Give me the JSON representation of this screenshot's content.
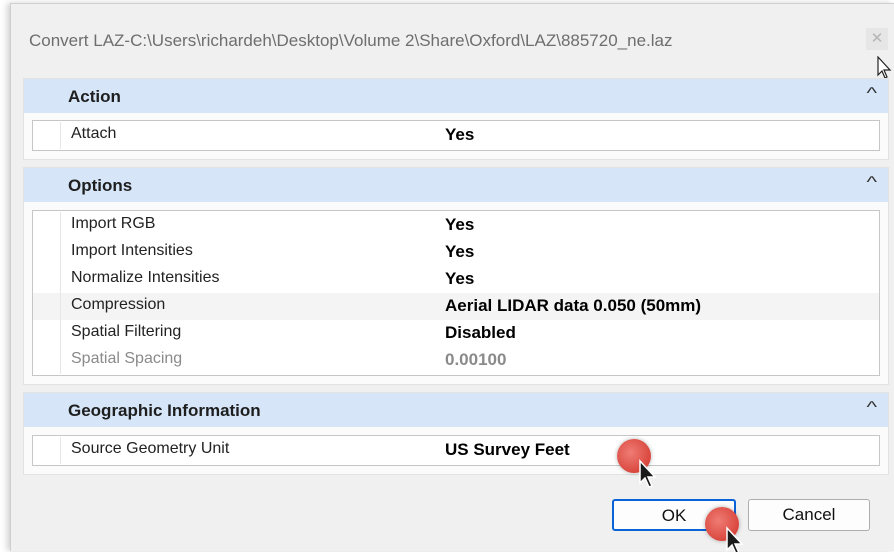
{
  "window": {
    "title": "Convert LAZ-C:\\Users\\richardeh\\Desktop\\Volume 2\\Share\\Oxford\\LAZ\\885720_ne.laz",
    "close_glyph": "✕"
  },
  "sections": {
    "action": {
      "title": "Action",
      "rows": [
        {
          "name": "Attach",
          "value": "Yes"
        }
      ]
    },
    "options": {
      "title": "Options",
      "rows": [
        {
          "name": "Import RGB",
          "value": "Yes"
        },
        {
          "name": "Import Intensities",
          "value": "Yes"
        },
        {
          "name": "Normalize Intensities",
          "value": "Yes"
        },
        {
          "name": "Compression",
          "value": "Aerial LIDAR data 0.050 (50mm)"
        },
        {
          "name": "Spatial Filtering",
          "value": "Disabled"
        },
        {
          "name": "Spatial Spacing",
          "value": "0.00100"
        }
      ]
    },
    "geographic": {
      "title": "Geographic Information",
      "rows": [
        {
          "name": "Source Geometry Unit",
          "value": "US Survey Feet"
        }
      ]
    }
  },
  "chevron_glyph": "^",
  "buttons": {
    "ok": "OK",
    "cancel": "Cancel"
  },
  "icons": {
    "collapse": "chevron-up-icon",
    "cursor": "mouse-pointer-icon",
    "click_marker": "click-indicator-icon"
  },
  "colors": {
    "section_header": "#d6e6f8",
    "default_button_border": "#0a64d8",
    "click_marker": "#d9473e"
  }
}
